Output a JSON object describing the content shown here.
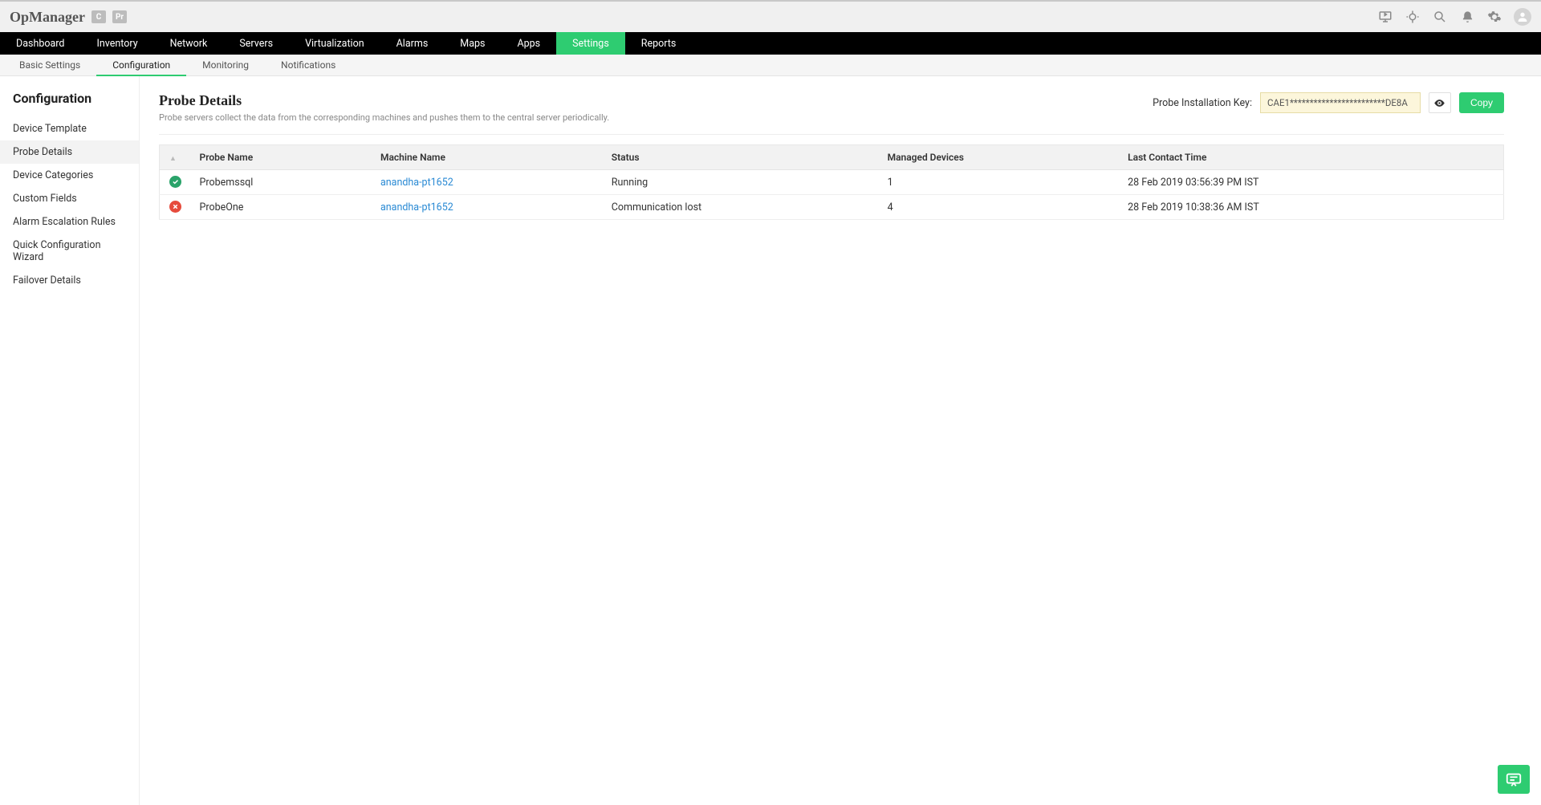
{
  "brand": {
    "name": "OpManager",
    "badge1": "C",
    "badge2": "Pr"
  },
  "mainnav": [
    "Dashboard",
    "Inventory",
    "Network",
    "Servers",
    "Virtualization",
    "Alarms",
    "Maps",
    "Apps",
    "Settings",
    "Reports"
  ],
  "mainnav_active": "Settings",
  "subnav": [
    "Basic Settings",
    "Configuration",
    "Monitoring",
    "Notifications"
  ],
  "subnav_active": "Configuration",
  "sidebar": {
    "title": "Configuration",
    "items": [
      "Device Template",
      "Probe Details",
      "Device Categories",
      "Custom Fields",
      "Alarm Escalation Rules",
      "Quick Configuration Wizard",
      "Failover Details"
    ],
    "active": "Probe Details"
  },
  "page": {
    "title": "Probe Details",
    "desc": "Probe servers collect the data from the corresponding machines and pushes them to the central server periodically.",
    "key_label": "Probe Installation Key:",
    "key_value": "CAE1************************DE8A",
    "copy_label": "Copy"
  },
  "table": {
    "headers": {
      "probe_name": "Probe Name",
      "machine_name": "Machine Name",
      "status": "Status",
      "managed_devices": "Managed Devices",
      "last_contact_time": "Last Contact Time"
    },
    "rows": [
      {
        "status_icon": "ok",
        "probe_name": "Probemssql",
        "machine_name": "anandha-pt1652",
        "status": "Running",
        "managed_devices": "1",
        "last_contact_time": "28 Feb 2019 03:56:39 PM IST"
      },
      {
        "status_icon": "err",
        "probe_name": "ProbeOne",
        "machine_name": "anandha-pt1652",
        "status": "Communication lost",
        "managed_devices": "4",
        "last_contact_time": "28 Feb 2019 10:38:36 AM IST"
      }
    ]
  }
}
